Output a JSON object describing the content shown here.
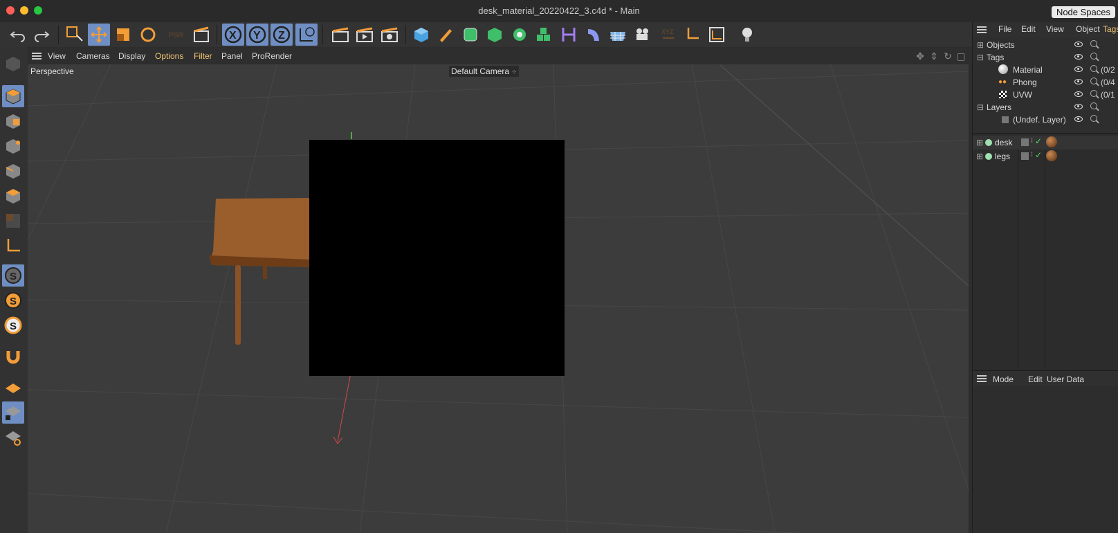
{
  "window": {
    "title": "desk_material_20220422_3.c4d * - Main",
    "node_spaces": "Node Spaces"
  },
  "viewport_menu": [
    "View",
    "Cameras",
    "Display",
    "Options",
    "Filter",
    "Panel",
    "ProRender"
  ],
  "viewport": {
    "view_label": "Perspective",
    "camera_label": "Default Camera"
  },
  "right_panel": {
    "menu": [
      "File",
      "Edit",
      "View",
      "Object",
      "Tags"
    ],
    "tree": [
      {
        "label": "Objects",
        "pct": ""
      },
      {
        "label": "Tags",
        "pct": ""
      },
      {
        "label": "Material",
        "pct": "(0/2"
      },
      {
        "label": "Phong",
        "pct": "(0/4"
      },
      {
        "label": "UVW",
        "pct": "(0/1"
      },
      {
        "label": "Layers",
        "pct": ""
      },
      {
        "label": "(Undef. Layer)",
        "pct": ""
      }
    ],
    "objects": [
      {
        "name": "desk"
      },
      {
        "name": "legs"
      }
    ],
    "attr_menu": [
      "Mode",
      "Edit",
      "User Data"
    ]
  },
  "colors": {
    "accent_selected": "#6f8fc4",
    "highlight_menu": "#f0c674",
    "orange_icon": "#f29d38"
  }
}
